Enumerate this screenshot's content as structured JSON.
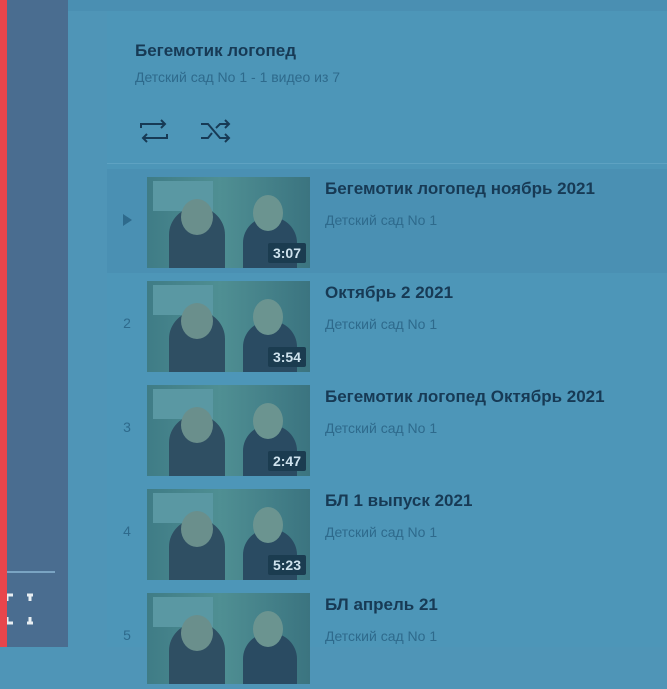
{
  "playlist": {
    "title": "Бегемотик логопед",
    "subtitle": "Детский сад No 1 - 1 видео из 7",
    "controls": [
      {
        "name": "loop-icon"
      },
      {
        "name": "shuffle-icon"
      }
    ]
  },
  "videos": [
    {
      "index": "",
      "current": true,
      "title": "Бегемотик логопед ноябрь 2021",
      "channel": "Детский сад No 1",
      "duration": "3:07"
    },
    {
      "index": "2",
      "current": false,
      "title": "Октябрь 2 2021",
      "channel": "Детский сад No 1",
      "duration": "3:54"
    },
    {
      "index": "3",
      "current": false,
      "title": "Бегемотик логопед Октябрь 2021",
      "channel": "Детский сад No 1",
      "duration": "2:47"
    },
    {
      "index": "4",
      "current": false,
      "title": "БЛ 1 выпуск 2021",
      "channel": "Детский сад No 1",
      "duration": "5:23"
    },
    {
      "index": "5",
      "current": false,
      "title": "БЛ апрель 21",
      "channel": "Детский сад No 1",
      "duration": ""
    }
  ],
  "colors": {
    "accent": "#e8454c",
    "panel": "#4d96b8"
  }
}
